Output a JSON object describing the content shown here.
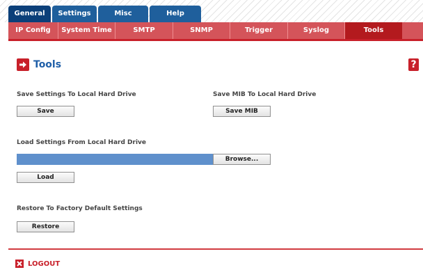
{
  "top_tabs": [
    {
      "label": "General",
      "active": true
    },
    {
      "label": "Settings",
      "active": false
    },
    {
      "label": "Misc",
      "active": false
    },
    {
      "label": "Help",
      "active": false
    }
  ],
  "sub_tabs": [
    {
      "label": "IP Config",
      "active": false
    },
    {
      "label": "System Time",
      "active": false
    },
    {
      "label": "SMTP",
      "active": false
    },
    {
      "label": "SNMP",
      "active": false
    },
    {
      "label": "Trigger",
      "active": false
    },
    {
      "label": "Syslog",
      "active": false
    },
    {
      "label": "Tools",
      "active": true
    }
  ],
  "page": {
    "title": "Tools",
    "title_icon": "arrow-right-icon",
    "help_glyph": "?"
  },
  "sections": {
    "save_settings_label": "Save Settings To Local Hard Drive",
    "save_button": "Save",
    "save_mib_label": "Save MIB To Local Hard Drive",
    "save_mib_button": "Save MIB",
    "load_settings_label": "Load Settings From Local Hard Drive",
    "browse_button": "Browse...",
    "load_button": "Load",
    "restore_label": "Restore To Factory Default Settings",
    "restore_button": "Restore"
  },
  "footer": {
    "logout_label": "LOGOUT",
    "logout_icon": "close-x-icon"
  },
  "colors": {
    "tab_blue": "#1f5f9c",
    "tab_blue_active": "#0b3f79",
    "nav_red": "#d4545a",
    "nav_red_active": "#b31a1e",
    "accent_red": "#c8202a",
    "title_blue": "#1f5fa8",
    "file_field_blue": "#5f90cc"
  }
}
